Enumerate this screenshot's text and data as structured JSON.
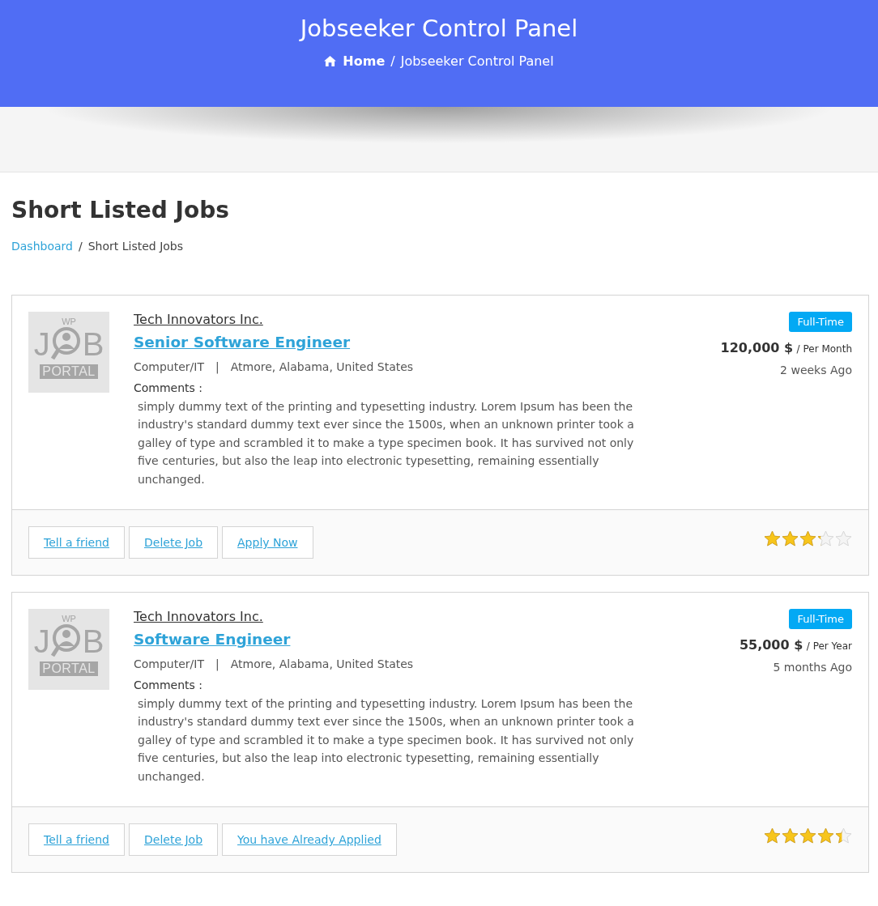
{
  "header": {
    "title": "Jobseeker Control Panel",
    "breadcrumb": {
      "home": "Home",
      "separator": "/",
      "current": "Jobseeker Control Panel"
    }
  },
  "page": {
    "title": "Short Listed Jobs",
    "breadcrumb": {
      "link": "Dashboard",
      "separator": "/",
      "current": "Short Listed Jobs"
    }
  },
  "jobs": [
    {
      "logo": {
        "top": "WP",
        "left": "J",
        "right": "B",
        "bottom": "PORTAL"
      },
      "company": "Tech Innovators Inc.",
      "title": "Senior Software Engineer",
      "category": "Computer/IT",
      "separator": "|",
      "location": "Atmore, Alabama, United States",
      "comments_label": "Comments :",
      "comments": "simply dummy text of the printing and typesetting industry. Lorem Ipsum has been the industry's standard dummy text ever since the 1500s, when an unknown printer took a galley of type and scrambled it to make a type specimen book. It has survived not only five centuries, but also the leap into electronic typesetting, remaining essentially unchanged.",
      "type": "Full-Time",
      "salary": "120,000 $",
      "period": "/ Per Month",
      "posted": "2 weeks Ago",
      "actions": [
        "Tell a friend",
        "Delete Job",
        "Apply Now"
      ],
      "stars": 3.2
    },
    {
      "logo": {
        "top": "WP",
        "left": "J",
        "right": "B",
        "bottom": "PORTAL"
      },
      "company": "Tech Innovators Inc.",
      "title": "Software Engineer",
      "category": "Computer/IT",
      "separator": "|",
      "location": "Atmore, Alabama, United States",
      "comments_label": "Comments :",
      "comments": "simply dummy text of the printing and typesetting industry. Lorem Ipsum has been the industry's standard dummy text ever since the 1500s, when an unknown printer took a galley of type and scrambled it to make a type specimen book. It has survived not only five centuries, but also the leap into electronic typesetting, remaining essentially unchanged.",
      "type": "Full-Time",
      "salary": "55,000 $",
      "period": "/ Per Year",
      "posted": "5 months Ago",
      "actions": [
        "Tell a friend",
        "Delete Job",
        "You have Already Applied"
      ],
      "stars": 4.4
    }
  ]
}
